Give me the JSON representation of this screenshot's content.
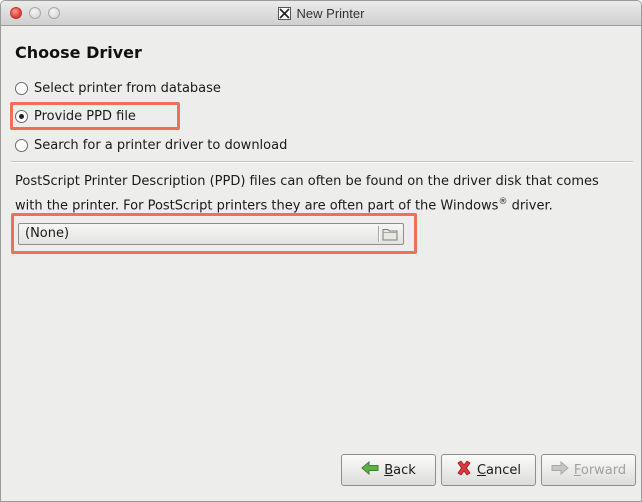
{
  "window": {
    "title": "New Printer"
  },
  "page": {
    "heading": "Choose Driver"
  },
  "options": [
    {
      "label": "Select printer from database",
      "selected": false
    },
    {
      "label": "Provide PPD file",
      "selected": true
    },
    {
      "label": "Search for a printer driver to download",
      "selected": false
    }
  ],
  "description": {
    "line1": "PostScript Printer Description (PPD) files can often be found on the driver disk that comes",
    "line2_pre": "with the printer. For PostScript printers they are often part of the Windows",
    "line2_mark": "®",
    "line2_post": " driver."
  },
  "file_chooser": {
    "value": "(None)",
    "icon": "folder-icon"
  },
  "buttons": {
    "back": {
      "first": "B",
      "rest": "ack",
      "icon": "arrow-left-icon",
      "enabled": true
    },
    "cancel": {
      "first": "C",
      "rest": "ancel",
      "icon": "cancel-x-icon",
      "enabled": true
    },
    "forward": {
      "first": "F",
      "rest": "orward",
      "icon": "arrow-right-icon",
      "enabled": false
    }
  },
  "colors": {
    "highlight": "#ef6f57",
    "back_arrow": "#5fb04a",
    "cancel_x": "#d8393f"
  }
}
